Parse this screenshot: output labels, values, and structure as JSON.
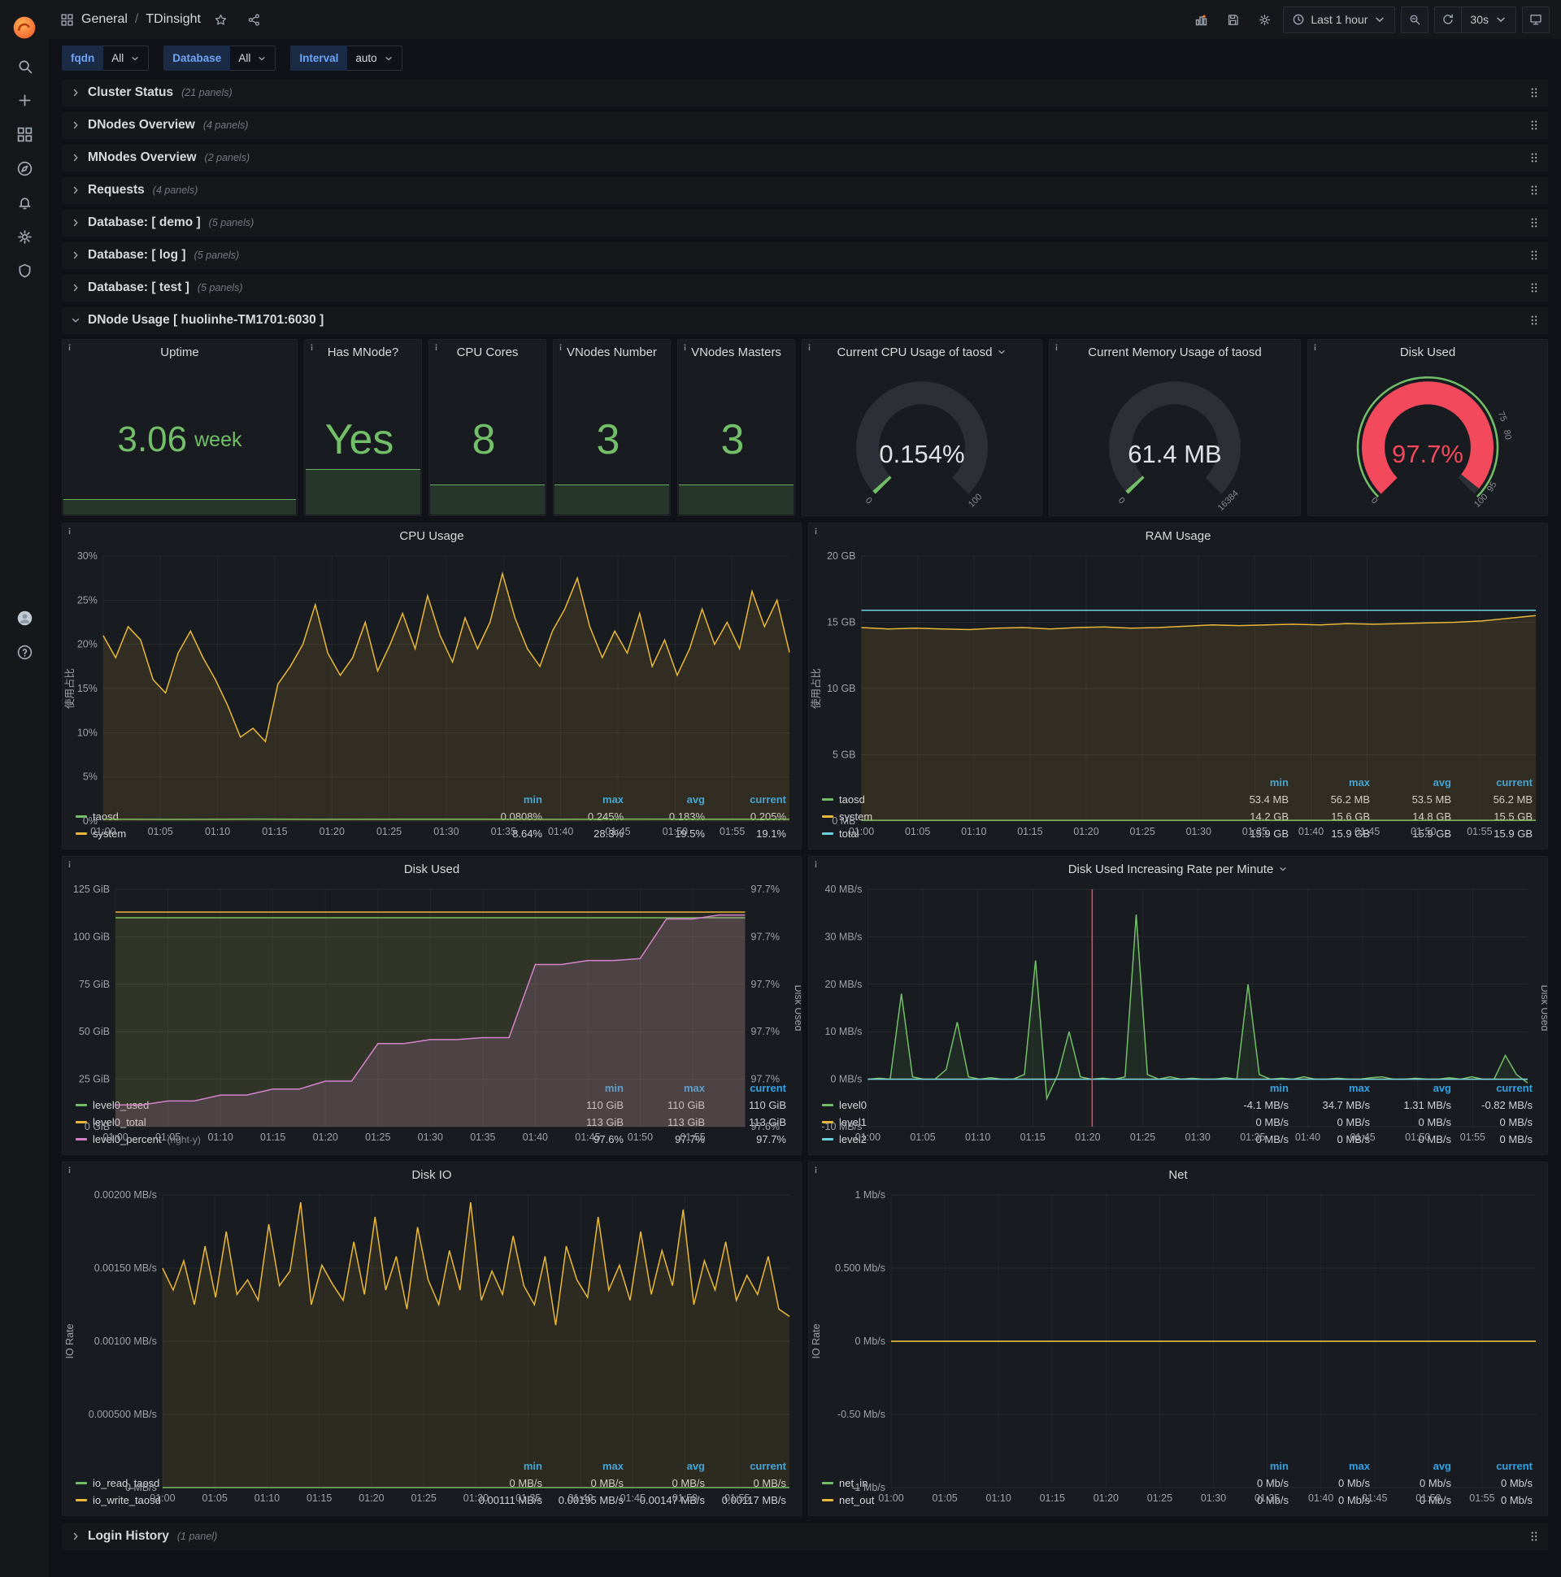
{
  "app": {
    "breadcrumb_section": "General",
    "breadcrumb_separator": "/",
    "breadcrumb_title": "TDinsight",
    "time_range_label": "Last 1 hour",
    "refresh_interval_label": "30s"
  },
  "variables": {
    "fqdn": {
      "label": "fqdn",
      "value": "All"
    },
    "database": {
      "label": "Database",
      "value": "All"
    },
    "interval": {
      "label": "Interval",
      "value": "auto"
    }
  },
  "rows": {
    "collapsed": [
      {
        "title": "Cluster Status",
        "count": "(21 panels)"
      },
      {
        "title": "DNodes Overview",
        "count": "(4 panels)"
      },
      {
        "title": "MNodes Overview",
        "count": "(2 panels)"
      },
      {
        "title": "Requests",
        "count": "(4 panels)"
      },
      {
        "title": "Database: [ demo ]",
        "count": "(5 panels)"
      },
      {
        "title": "Database: [ log ]",
        "count": "(5 panels)"
      },
      {
        "title": "Database: [ test ]",
        "count": "(5 panels)"
      }
    ],
    "expanded": {
      "title": "DNode Usage [ huolinhe-TM1701:6030 ]"
    },
    "bottom": {
      "title": "Login History",
      "count": "(1 panel)"
    }
  },
  "stats": [
    {
      "title": "Uptime",
      "value": "3.06",
      "unit": "week"
    },
    {
      "title": "Has MNode?",
      "value": "Yes",
      "unit": ""
    },
    {
      "title": "CPU Cores",
      "value": "8",
      "unit": ""
    },
    {
      "title": "VNodes Number",
      "value": "3",
      "unit": ""
    },
    {
      "title": "VNodes Masters",
      "value": "3",
      "unit": ""
    }
  ],
  "gauges": [
    {
      "title": "Current CPU Usage of taosd",
      "value": "0.154%",
      "frac": 0.00154,
      "arc_color": "#73bf69",
      "value_color": "#dfe1e5",
      "labels": [
        [
          0,
          "0"
        ],
        [
          1,
          "100"
        ]
      ]
    },
    {
      "title": "Current Memory Usage of taosd",
      "value": "61.4 MB",
      "frac": 0.00375,
      "arc_color": "#73bf69",
      "value_color": "#dfe1e5",
      "labels": [
        [
          0,
          "0"
        ],
        [
          1,
          "16384"
        ]
      ]
    },
    {
      "title": "Disk Used",
      "value": "97.7%",
      "frac": 0.977,
      "arc_color": "#f2495c",
      "value_color": "#f2495c",
      "ring_color": "#73bf69",
      "labels": [
        [
          0,
          "0"
        ],
        [
          0.75,
          "75"
        ],
        [
          0.8,
          "80"
        ],
        [
          0.95,
          "95"
        ],
        [
          1,
          "100"
        ]
      ]
    }
  ],
  "charts": [
    {
      "type": "line",
      "title": "CPU Usage",
      "ylabel": "使用占比",
      "ymin": 0,
      "ymax": 30,
      "yticks": [
        [
          30,
          "30%"
        ],
        [
          25,
          "25%"
        ],
        [
          20,
          "20%"
        ],
        [
          15,
          "15%"
        ],
        [
          10,
          "10%"
        ],
        [
          5,
          "5%"
        ],
        [
          0,
          "0%"
        ]
      ],
      "xticks": [
        "01:00",
        "01:05",
        "01:10",
        "01:15",
        "01:20",
        "01:25",
        "01:30",
        "01:35",
        "01:40",
        "01:45",
        "01:50",
        "01:55"
      ],
      "legend_cols": [
        "min",
        "max",
        "avg",
        "current"
      ],
      "series": [
        {
          "name": "taosd",
          "color": "#73bf69",
          "fill": 0,
          "values": [
            0.2,
            0.18,
            0.22,
            0.19,
            0.21,
            0.2,
            0.19,
            0.22,
            0.2,
            0.21
          ],
          "stats": [
            "0.0808%",
            "0.245%",
            "0.183%",
            "0.205%"
          ]
        },
        {
          "name": "system",
          "color": "#eab839",
          "fill": 0.12,
          "values": [
            21,
            18.5,
            22,
            20.5,
            16,
            14.5,
            19,
            21.5,
            18.5,
            16,
            13,
            9.5,
            10.5,
            9,
            15.5,
            17.5,
            20,
            24.5,
            19,
            16.5,
            18.5,
            22.5,
            17,
            20,
            23.5,
            19.5,
            25.5,
            21,
            18,
            23,
            19.5,
            22.5,
            28,
            23,
            19.5,
            17.5,
            21.5,
            24,
            27.5,
            22,
            18.5,
            21.5,
            19,
            23.5,
            17.5,
            20.5,
            16.5,
            19.5,
            24,
            20,
            22.5,
            19.5,
            26,
            22,
            25,
            19.1
          ],
          "stats": [
            "8.64%",
            "28.3%",
            "19.5%",
            "19.1%"
          ]
        }
      ]
    },
    {
      "type": "line",
      "title": "RAM Usage",
      "ylabel": "使用占比",
      "ymin": 0,
      "ymax": 20,
      "yticks": [
        [
          20,
          "20 GB"
        ],
        [
          15,
          "15 GB"
        ],
        [
          10,
          "10 GB"
        ],
        [
          5,
          "5 GB"
        ],
        [
          0,
          "0 MB"
        ]
      ],
      "xticks": [
        "01:00",
        "01:05",
        "01:10",
        "01:15",
        "01:20",
        "01:25",
        "01:30",
        "01:35",
        "01:40",
        "01:45",
        "01:50",
        "01:55"
      ],
      "legend_cols": [
        "min",
        "max",
        "avg",
        "current"
      ],
      "series": [
        {
          "name": "taosd",
          "color": "#73bf69",
          "fill": 0,
          "values": [
            0.053,
            0.053,
            0.054,
            0.054,
            0.055,
            0.055
          ],
          "stats": [
            "53.4 MB",
            "56.2 MB",
            "53.5 MB",
            "56.2 MB"
          ]
        },
        {
          "name": "system",
          "color": "#eab839",
          "fill": 0.12,
          "values": [
            14.6,
            14.5,
            14.55,
            14.5,
            14.45,
            14.55,
            14.6,
            14.5,
            14.6,
            14.65,
            14.55,
            14.6,
            14.7,
            14.8,
            14.75,
            14.8,
            14.85,
            14.8,
            14.9,
            14.85,
            14.9,
            14.95,
            15.0,
            15.1,
            15.3,
            15.5
          ],
          "stats": [
            "14.2 GB",
            "15.6 GB",
            "14.8 GB",
            "15.5 GB"
          ]
        },
        {
          "name": "total",
          "color": "#6ed0e0",
          "fill": 0,
          "values": [
            15.9,
            15.9,
            15.9,
            15.9,
            15.9,
            15.9,
            15.9,
            15.9
          ],
          "stats": [
            "15.9 GB",
            "15.9 GB",
            "15.9 GB",
            "15.9 GB"
          ]
        }
      ]
    },
    {
      "type": "line",
      "title": "Disk Used",
      "ymin": 0,
      "ymax": 125,
      "yticks": [
        [
          125,
          "125 GiB"
        ],
        [
          100,
          "100 GiB"
        ],
        [
          75,
          "75 GiB"
        ],
        [
          50,
          "50 GiB"
        ],
        [
          25,
          "25 GiB"
        ],
        [
          0,
          "0 GiB"
        ]
      ],
      "y2ticks": [
        "97.7%",
        "97.7%",
        "97.7%",
        "97.7%",
        "97.7%",
        "97.6%"
      ],
      "y2label": "Disk Used",
      "y2min": 97.59,
      "y2max": 97.71,
      "xticks": [
        "01:00",
        "01:05",
        "01:10",
        "01:15",
        "01:20",
        "01:25",
        "01:30",
        "01:35",
        "01:40",
        "01:45",
        "01:50",
        "01:55"
      ],
      "legend_cols": [
        "min",
        "max",
        "current"
      ],
      "series": [
        {
          "name": "level0_used",
          "color": "#73bf69",
          "fill": 0.1,
          "values": [
            110,
            110,
            110,
            110,
            110,
            110,
            110,
            110
          ],
          "stats": [
            "110 GiB",
            "110 GiB",
            "110 GiB"
          ]
        },
        {
          "name": "level0_total",
          "color": "#eab839",
          "fill": 0.08,
          "values": [
            113,
            113,
            113,
            113,
            113,
            113,
            113,
            113
          ],
          "stats": [
            "113 GiB",
            "113 GiB",
            "113 GiB"
          ]
        },
        {
          "name": "level0_percent",
          "note": "(right-y)",
          "color": "#d683ce",
          "axis": "right",
          "fill": 0.18,
          "values": [
            97.601,
            97.601,
            97.603,
            97.603,
            97.606,
            97.606,
            97.609,
            97.609,
            97.613,
            97.613,
            97.632,
            97.632,
            97.634,
            97.634,
            97.635,
            97.635,
            97.672,
            97.672,
            97.674,
            97.674,
            97.675,
            97.695,
            97.695,
            97.697,
            97.697
          ],
          "stats": [
            "97.6%",
            "97.7%",
            "97.7%"
          ]
        }
      ]
    },
    {
      "type": "line",
      "title": "Disk Used Increasing Rate per Minute",
      "ymin": -10,
      "ymax": 40,
      "yticks": [
        [
          40,
          "40 MB/s"
        ],
        [
          30,
          "30 MB/s"
        ],
        [
          20,
          "20 MB/s"
        ],
        [
          10,
          "10 MB/s"
        ],
        [
          0,
          "0 MB/s"
        ],
        [
          -10,
          "-10 MB/s"
        ]
      ],
      "y2label": "Disk Used",
      "xticks": [
        "01:00",
        "01:05",
        "01:10",
        "01:15",
        "01:20",
        "01:25",
        "01:30",
        "01:35",
        "01:40",
        "01:45",
        "01:50",
        "01:55"
      ],
      "annotation": {
        "x": 0.34,
        "color": "#f2495c"
      },
      "legend_cols": [
        "min",
        "max",
        "avg",
        "current"
      ],
      "series": [
        {
          "name": "level0",
          "color": "#73bf69",
          "fill": 0.1,
          "values": [
            0,
            0.2,
            0,
            18,
            0.5,
            0,
            0,
            2,
            12,
            0.5,
            0,
            0.3,
            0,
            0,
            1,
            25,
            -4.1,
            1,
            10,
            0.5,
            0,
            0.2,
            0,
            0.5,
            34.7,
            1,
            0,
            0.5,
            0,
            0.2,
            0,
            0,
            0.3,
            0,
            20,
            1,
            0,
            0.2,
            0,
            0.5,
            0,
            0,
            0.2,
            0,
            0,
            0.3,
            0.5,
            0,
            0,
            0.2,
            0,
            0,
            0.3,
            0,
            0.5,
            0,
            0,
            5,
            1,
            -0.8
          ],
          "stats": [
            "-4.1 MB/s",
            "34.7 MB/s",
            "1.31 MB/s",
            "-0.82 MB/s"
          ]
        },
        {
          "name": "level1",
          "color": "#eab839",
          "fill": 0,
          "values": [
            0,
            0,
            0,
            0,
            0
          ],
          "stats": [
            "0 MB/s",
            "0 MB/s",
            "0 MB/s",
            "0 MB/s"
          ]
        },
        {
          "name": "level2",
          "color": "#6ed0e0",
          "fill": 0,
          "values": [
            0,
            0,
            0,
            0,
            0
          ],
          "stats": [
            "0 MB/s",
            "0 MB/s",
            "0 MB/s",
            "0 MB/s"
          ]
        }
      ]
    },
    {
      "type": "line",
      "title": "Disk IO",
      "ylabel": "IO Rate",
      "ymin": 0,
      "ymax": 0.002,
      "yticks": [
        [
          0.002,
          "0.00200 MB/s"
        ],
        [
          0.0015,
          "0.00150 MB/s"
        ],
        [
          0.001,
          "0.00100 MB/s"
        ],
        [
          0.0005,
          "0.000500 MB/s"
        ],
        [
          0,
          "0 MB/s"
        ]
      ],
      "xticks": [
        "01:00",
        "01:05",
        "01:10",
        "01:15",
        "01:20",
        "01:25",
        "01:30",
        "01:35",
        "01:40",
        "01:45",
        "01:50",
        "01:55"
      ],
      "legend_cols": [
        "min",
        "max",
        "avg",
        "current"
      ],
      "series": [
        {
          "name": "io_read_taosd",
          "color": "#73bf69",
          "fill": 0,
          "values": [
            0,
            0,
            0,
            0,
            0
          ],
          "stats": [
            "0 MB/s",
            "0 MB/s",
            "0 MB/s",
            "0 MB/s"
          ]
        },
        {
          "name": "io_write_taosd",
          "color": "#eab839",
          "fill": 0.1,
          "values": [
            0.0015,
            0.00135,
            0.00155,
            0.00125,
            0.00165,
            0.0013,
            0.00175,
            0.00132,
            0.00142,
            0.00128,
            0.0018,
            0.00138,
            0.00148,
            0.00195,
            0.00125,
            0.00152,
            0.00139,
            0.00128,
            0.00168,
            0.00132,
            0.00185,
            0.00135,
            0.00158,
            0.00122,
            0.00178,
            0.00142,
            0.00125,
            0.00162,
            0.00135,
            0.00195,
            0.00128,
            0.00148,
            0.00132,
            0.00172,
            0.00138,
            0.00125,
            0.00158,
            0.00111,
            0.00165,
            0.00142,
            0.0013,
            0.00185,
            0.00135,
            0.00152,
            0.00128,
            0.00175,
            0.00132,
            0.00162,
            0.00138,
            0.0019,
            0.00125,
            0.00155,
            0.00135,
            0.00168,
            0.00128,
            0.00145,
            0.00132,
            0.00158,
            0.00122,
            0.00117
          ],
          "stats": [
            "0.00111 MB/s",
            "0.00195 MB/s",
            "0.00147 MB/s",
            "0.00117 MB/s"
          ]
        }
      ]
    },
    {
      "type": "line",
      "title": "Net",
      "ylabel": "IO Rate",
      "ymin": -1,
      "ymax": 1,
      "yticks": [
        [
          1,
          "1 Mb/s"
        ],
        [
          0.5,
          "0.500 Mb/s"
        ],
        [
          0,
          "0 Mb/s"
        ],
        [
          -0.5,
          "-0.50 Mb/s"
        ],
        [
          -1,
          "-1 Mb/s"
        ]
      ],
      "xticks": [
        "01:00",
        "01:05",
        "01:10",
        "01:15",
        "01:20",
        "01:25",
        "01:30",
        "01:35",
        "01:40",
        "01:45",
        "01:50",
        "01:55"
      ],
      "legend_cols": [
        "min",
        "max",
        "avg",
        "current"
      ],
      "series": [
        {
          "name": "net_in",
          "color": "#73bf69",
          "fill": 0,
          "values": [
            0,
            0,
            0,
            0,
            0
          ],
          "stats": [
            "0 Mb/s",
            "0 Mb/s",
            "0 Mb/s",
            "0 Mb/s"
          ]
        },
        {
          "name": "net_out",
          "color": "#eab839",
          "fill": 0,
          "values": [
            0,
            0,
            0,
            0,
            0
          ],
          "stats": [
            "0 Mb/s",
            "0 Mb/s",
            "0 Mb/s",
            "0 Mb/s"
          ]
        }
      ]
    }
  ]
}
